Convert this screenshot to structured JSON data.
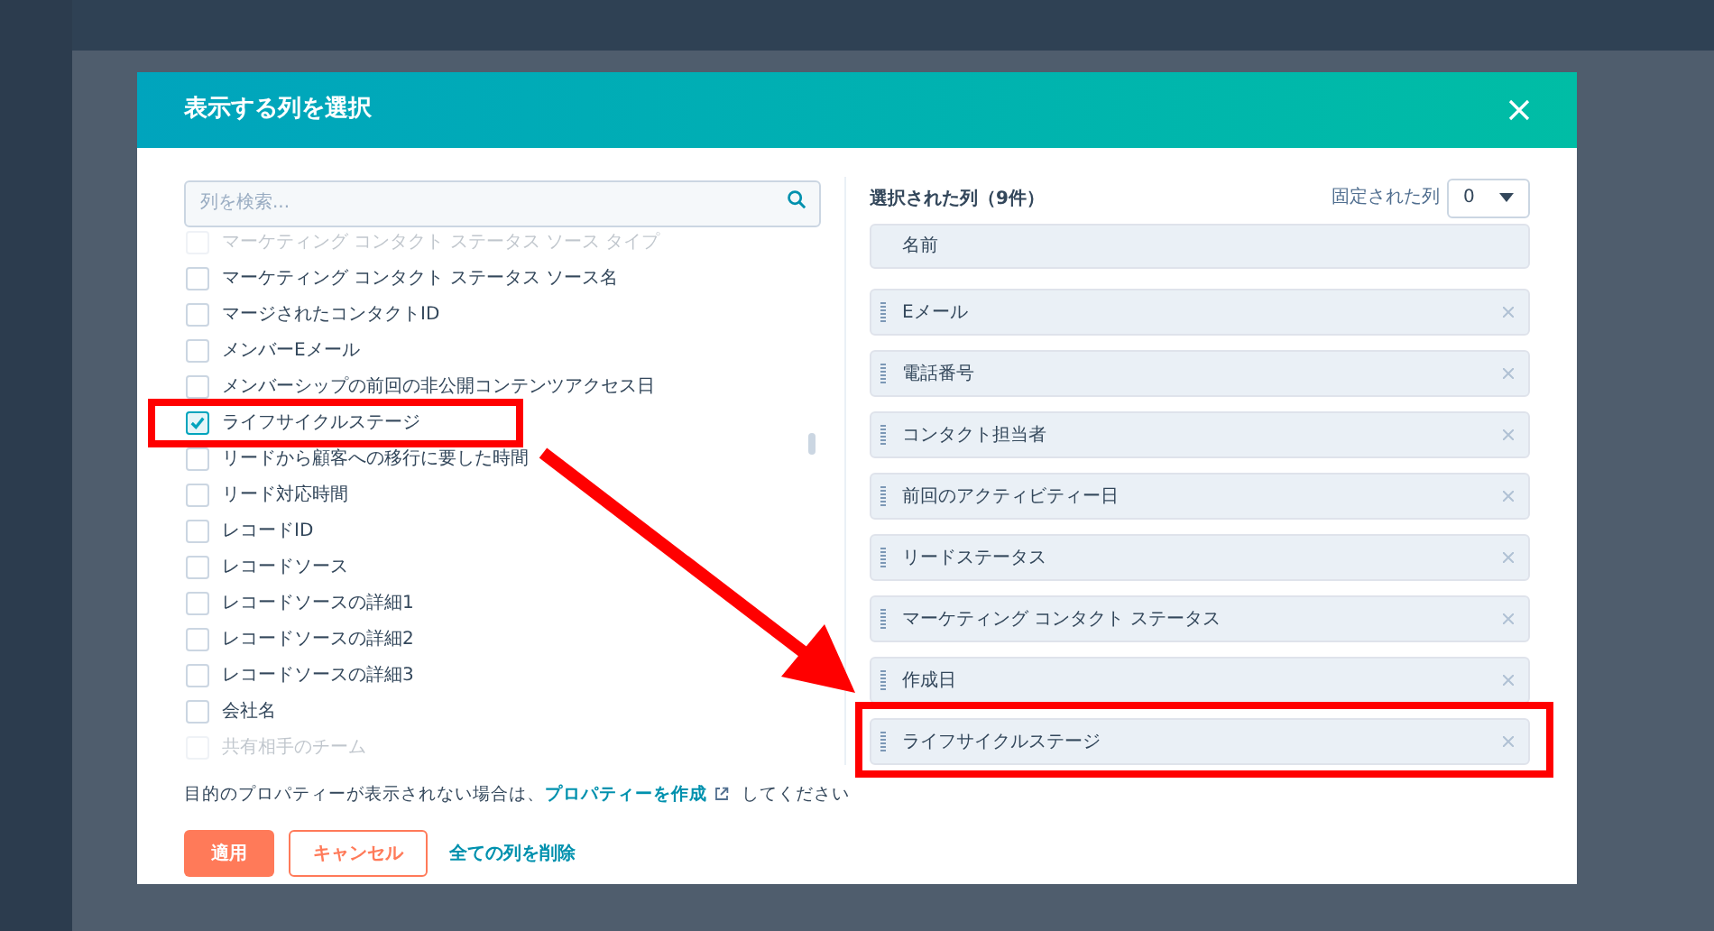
{
  "dialog": {
    "title": "表示する列を選択"
  },
  "search": {
    "placeholder": "列を検索..."
  },
  "available_columns": [
    {
      "label": "マーケティング コンタクト ステータス ソース タイプ",
      "checked": false,
      "cut_off": true
    },
    {
      "label": "マーケティング コンタクト ステータス ソース名",
      "checked": false,
      "cut_off": false
    },
    {
      "label": "マージされたコンタクトID",
      "checked": false,
      "cut_off": false
    },
    {
      "label": "メンバーEメール",
      "checked": false,
      "cut_off": false
    },
    {
      "label": "メンバーシップの前回の非公開コンテンツアクセス日",
      "checked": false,
      "cut_off": false
    },
    {
      "label": "ライフサイクルステージ",
      "checked": true,
      "cut_off": false
    },
    {
      "label": "リードから顧客への移行に要した時間",
      "checked": false,
      "cut_off": false
    },
    {
      "label": "リード対応時間",
      "checked": false,
      "cut_off": false
    },
    {
      "label": "レコードID",
      "checked": false,
      "cut_off": false
    },
    {
      "label": "レコードソース",
      "checked": false,
      "cut_off": false
    },
    {
      "label": "レコードソースの詳細1",
      "checked": false,
      "cut_off": false
    },
    {
      "label": "レコードソースの詳細2",
      "checked": false,
      "cut_off": false
    },
    {
      "label": "レコードソースの詳細3",
      "checked": false,
      "cut_off": false
    },
    {
      "label": "会社名",
      "checked": false,
      "cut_off": false
    },
    {
      "label": "共有相手のチーム",
      "checked": false,
      "cut_off": true
    }
  ],
  "selected_panel": {
    "heading": "選択された列（9件）",
    "pinned_label": "固定された列",
    "pinned_value": "0",
    "columns": [
      {
        "label": "名前",
        "kind": "fixed"
      },
      {
        "label": "Eメール",
        "kind": "movable"
      },
      {
        "label": "電話番号",
        "kind": "movable"
      },
      {
        "label": "コンタクト担当者",
        "kind": "movable"
      },
      {
        "label": "前回のアクティビティー日",
        "kind": "movable"
      },
      {
        "label": "リードステータス",
        "kind": "movable"
      },
      {
        "label": "マーケティング コンタクト ステータス",
        "kind": "movable"
      },
      {
        "label": "作成日",
        "kind": "movable"
      },
      {
        "label": "ライフサイクルステージ",
        "kind": "movable"
      }
    ]
  },
  "hint": {
    "before": "目的のプロパティーが表示されない場合は、",
    "link": "プロパティーを作成",
    "after": " してください"
  },
  "buttons": [
    {
      "label": "適用",
      "kind": "primary"
    },
    {
      "label": "キャンセル",
      "kind": "secondary"
    },
    {
      "label": "全ての列を削除",
      "kind": "link"
    }
  ]
}
